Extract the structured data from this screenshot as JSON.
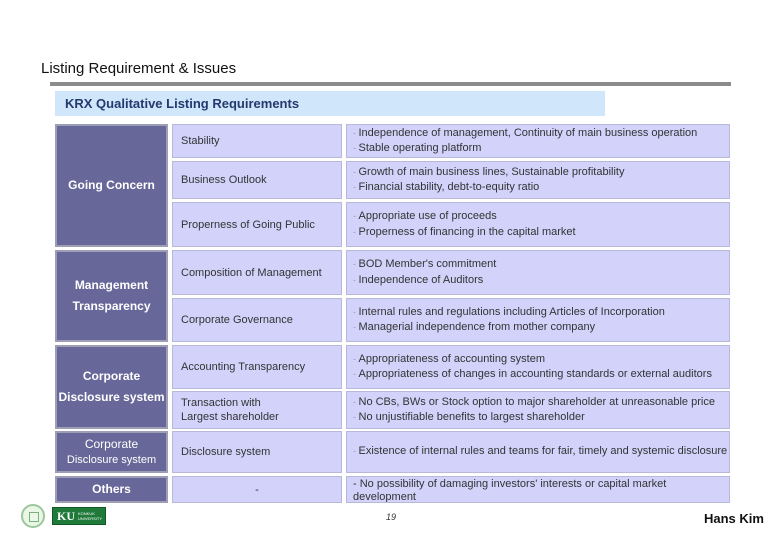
{
  "slide": {
    "title": "Listing Requirement & Issues",
    "table_heading": "KRX Qualitative Listing Requirements",
    "page_number": "19",
    "author": "Hans Kim",
    "logos": {
      "seal": "university-seal-logo",
      "brand_text": "KU",
      "brand_subtext": "KONKUK UNIVERSITY"
    }
  },
  "colors": {
    "category_bg": "#67679a",
    "cell_bg": "#d2d2fb",
    "heading_band_bg": "#cfe6fb",
    "heading_text": "#243a6e",
    "rule": "#8c8c8c"
  },
  "table": {
    "groups": [
      {
        "category": "Going Concern",
        "rows": [
          {
            "item": "Stability",
            "details": [
              "Independence of management,  Continuity of main business operation",
              "Stable operating platform"
            ]
          },
          {
            "item": "Business Outlook",
            "details": [
              "Growth of main business lines,  Sustainable profitability",
              "Financial stability, debt-to-equity ratio"
            ]
          },
          {
            "item": "Properness of Going Public",
            "details": [
              "Appropriate use of proceeds",
              "Properness of financing in the capital market"
            ]
          }
        ]
      },
      {
        "category": "Management Transparency",
        "category_lines": [
          "Management",
          "Transparency"
        ],
        "rows": [
          {
            "item": "Composition of Management",
            "details": [
              "BOD Member's commitment",
              "Independence of Auditors"
            ]
          },
          {
            "item": "Corporate Governance",
            "details": [
              "Internal rules and regulations  including Articles of Incorporation",
              "Managerial independence from mother company"
            ]
          }
        ]
      },
      {
        "category": "Corporate Disclosure system",
        "category_lines": [
          "Corporate",
          "Disclosure system"
        ],
        "rows": [
          {
            "item": "Accounting Transparency",
            "details": [
              "Appropriateness of accounting system",
              "Appropriateness of changes in accounting standards or external auditors"
            ]
          },
          {
            "item": "Transaction with Largest shareholder",
            "item_lines": [
              "Transaction with",
              "Largest shareholder"
            ],
            "details": [
              "No CBs, BWs or Stock option to major shareholder at unreasonable price",
              "No unjustifiable benefits to largest shareholder"
            ]
          }
        ]
      },
      {
        "category": "Corporate Disclosure system",
        "category_lines": [
          "Corporate",
          "Disclosure system"
        ],
        "rows": [
          {
            "item": "Disclosure system",
            "details": [
              "Existence of internal rules and teams for fair, timely and systemic disclosure"
            ]
          }
        ]
      },
      {
        "category": "Others",
        "rows": [
          {
            "item": "-",
            "details": [
              "- No possibility of damaging investors' interests or capital market",
              "development"
            ]
          }
        ]
      }
    ]
  }
}
